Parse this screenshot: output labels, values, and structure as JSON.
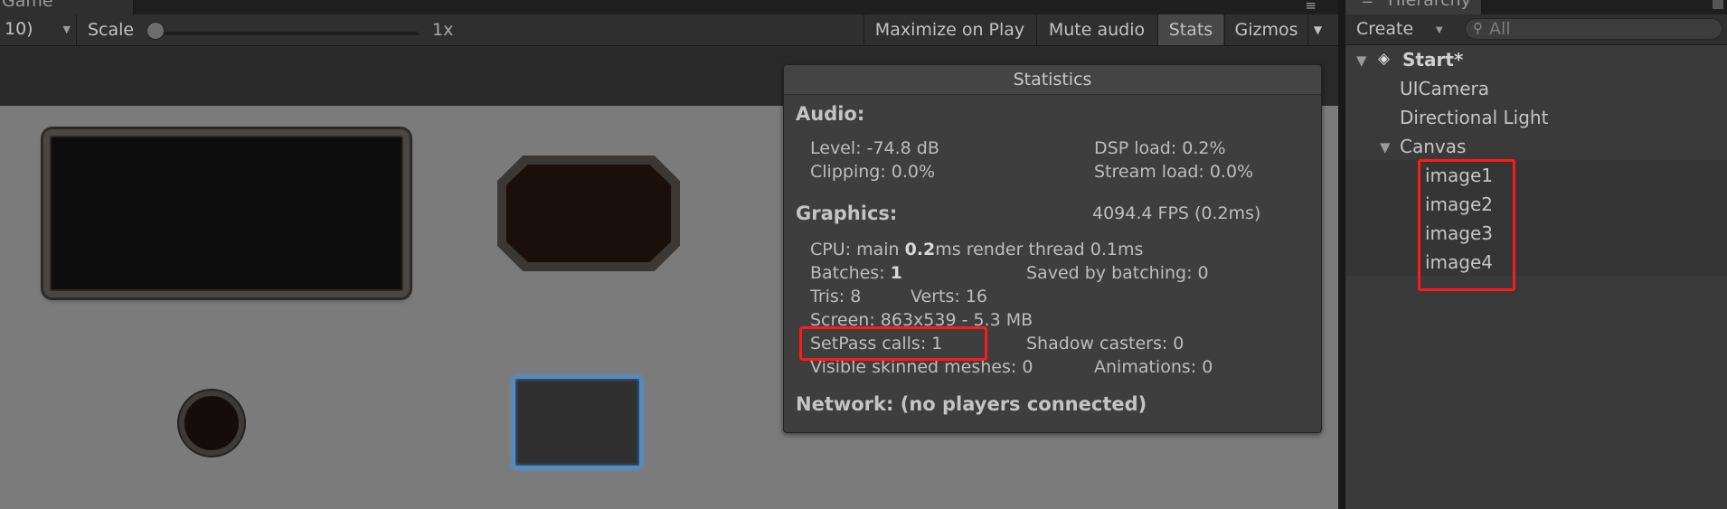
{
  "game": {
    "tab_label": "Game",
    "menu_icon": "≡",
    "aspect_label": "10)",
    "scale_label": "Scale",
    "scale_value": "1x",
    "buttons": {
      "maximize": "Maximize on Play",
      "mute": "Mute audio",
      "stats": "Stats",
      "gizmos": "Gizmos"
    }
  },
  "statistics": {
    "title": "Statistics",
    "audio_header": "Audio:",
    "level": "Level: -74.8 dB",
    "dsp_load": "DSP load: 0.2%",
    "clipping": "Clipping: 0.0%",
    "stream_load": "Stream load: 0.0%",
    "graphics_header": "Graphics:",
    "fps": "4094.4 FPS (0.2ms)",
    "cpu_prefix": "CPU: main ",
    "cpu_main_value": "0.2",
    "cpu_suffix": "ms  render thread 0.1ms",
    "batches_prefix": "Batches: ",
    "batches_value": "1",
    "saved_by_batching": "Saved by batching: 0",
    "tris": "Tris: 8",
    "verts": "Verts: 16",
    "screen": "Screen: 863x539 - 5.3 MB",
    "setpass": "SetPass calls: 1",
    "shadow_casters": "Shadow casters: 0",
    "visible_skinned": "Visible skinned meshes: 0",
    "animations": "Animations: 0",
    "network": "Network: (no players connected)"
  },
  "hierarchy": {
    "tab_label": "Hierarchy",
    "create_label": "Create",
    "search_placeholder": "All",
    "scene_name": "Start*",
    "items": [
      "UICamera",
      "Directional Light",
      "Canvas"
    ],
    "canvas_children": [
      "image1",
      "image2",
      "image3",
      "image4"
    ]
  },
  "colors": {
    "highlight": "#ff1a1a",
    "selection_glow": "#3f8fe0"
  }
}
